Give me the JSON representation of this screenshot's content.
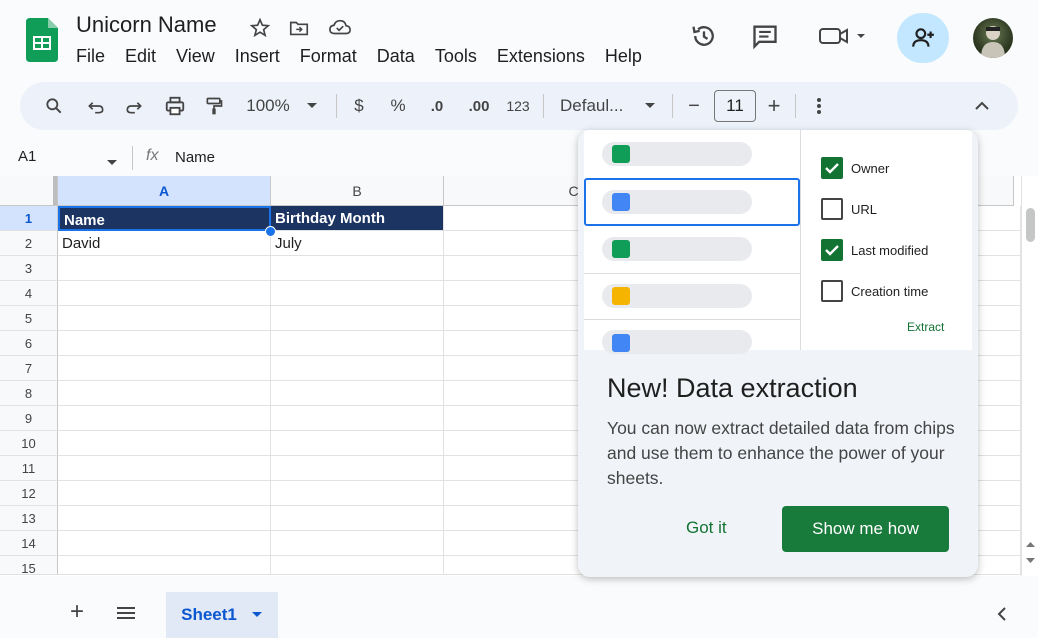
{
  "header": {
    "title": "Unicorn Name",
    "menu": [
      "File",
      "Edit",
      "View",
      "Insert",
      "Format",
      "Data",
      "Tools",
      "Extensions",
      "Help"
    ]
  },
  "toolbar": {
    "zoom": "100%",
    "currency": "$",
    "percent": "%",
    "dec_decrease": ".0",
    "dec_increase": ".00",
    "number_format": "123",
    "font": "Defaul...",
    "font_size": "11",
    "minus": "−",
    "plus": "+"
  },
  "formula_bar": {
    "name_box": "A1",
    "fx": "fx",
    "value": "Name"
  },
  "grid": {
    "columns": [
      "A",
      "B",
      "C"
    ],
    "rows": [
      "1",
      "2",
      "3",
      "4",
      "5",
      "6",
      "7",
      "8",
      "9",
      "10",
      "11",
      "12",
      "13",
      "14",
      "15"
    ],
    "cells": {
      "A1": "Name",
      "B1": "Birthday Month",
      "A2": "David",
      "B2": "July"
    }
  },
  "sheets": {
    "add": "+",
    "active": "Sheet1"
  },
  "popup": {
    "options": [
      {
        "label": "Owner",
        "checked": true
      },
      {
        "label": "URL",
        "checked": false
      },
      {
        "label": "Last modified",
        "checked": true
      },
      {
        "label": "Creation time",
        "checked": false
      }
    ],
    "extract_label": "Extract",
    "title": "New! Data extraction",
    "body": "You can now extract detailed data from chips and use them to enhance the power of your sheets.",
    "dismiss": "Got it",
    "cta": "Show me how"
  },
  "colors": {
    "accent_green": "#137333",
    "cta_green": "#187a3b",
    "header_fill": "#1c3461",
    "share_bg": "#c2e7ff",
    "toolbar_bg": "#edf2fa"
  }
}
